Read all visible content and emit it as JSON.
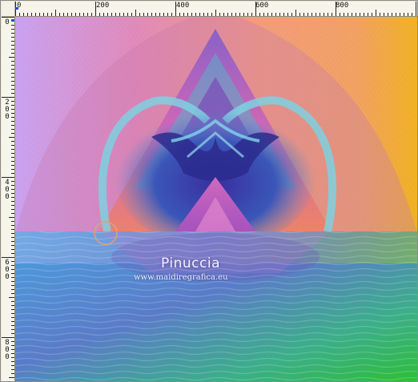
{
  "ruler": {
    "top_labels": [
      "0",
      "200",
      "400",
      "600",
      "800"
    ],
    "left_labels": [
      "0",
      "200",
      "400",
      "600",
      "800"
    ],
    "accent_color": "#1f4fd8"
  },
  "canvas": {
    "watermark_name": "Pinuccia",
    "watermark_url": "www.maidiregrafica.eu",
    "cursor_icon": "brush-circle-cursor-icon"
  }
}
